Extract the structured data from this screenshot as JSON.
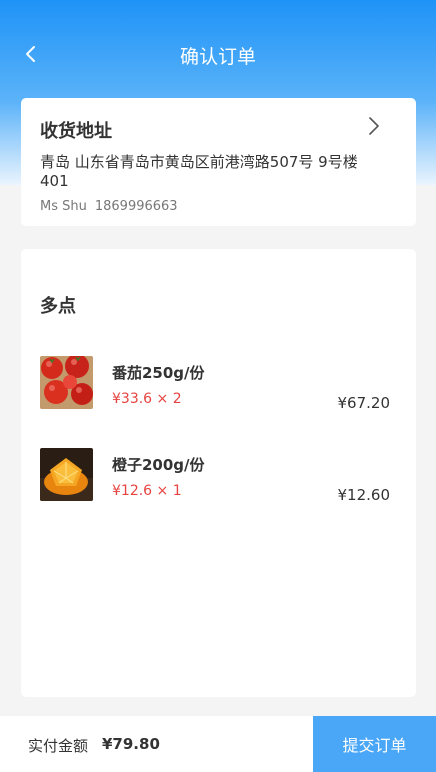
{
  "nav": {
    "title": "确认订单",
    "back_icon": "chevron-left-icon"
  },
  "address": {
    "label": "收货地址",
    "text": "青岛 山东省青岛市黄岛区前港湾路507号 9号楼401",
    "name": "Ms Shu",
    "phone": "1869996663",
    "arrow_icon": "chevron-right-icon"
  },
  "order": {
    "store": "多点",
    "items": [
      {
        "name": "番茄250g/份",
        "unit": "¥33.6 × 2",
        "total": "¥67.20",
        "image": "tomato-photo"
      },
      {
        "name": "橙子200g/份",
        "unit": "¥12.6 × 1",
        "total": "¥12.60",
        "image": "orange-photo"
      }
    ]
  },
  "footer": {
    "pay_label": "实付金额",
    "pay_amount": "¥79.80",
    "submit_label": "提交订单"
  },
  "colors": {
    "accent": "#1e93f7",
    "price_red": "#e64340",
    "submit_bg": "#4aa6f6"
  }
}
